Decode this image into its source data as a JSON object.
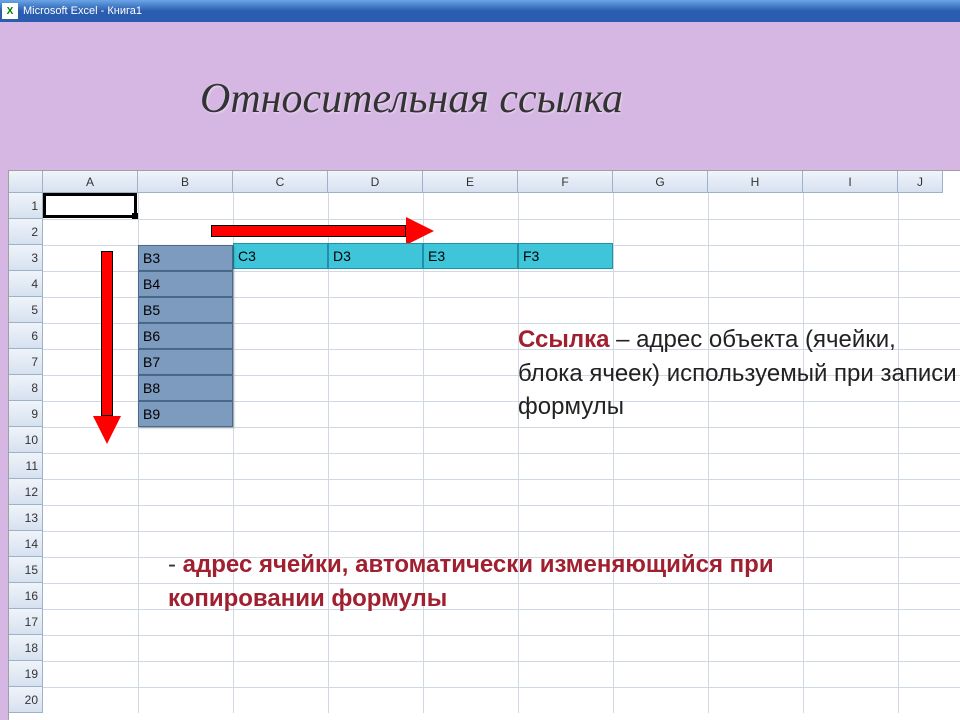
{
  "app_title": "Microsoft Excel - Книга1",
  "slide_heading": "Относительная ссылка",
  "columns": [
    "A",
    "B",
    "C",
    "D",
    "E",
    "F",
    "G",
    "H",
    "I",
    "J"
  ],
  "rows": [
    "1",
    "2",
    "3",
    "4",
    "5",
    "6",
    "7",
    "8",
    "9",
    "10",
    "11",
    "12",
    "13",
    "14",
    "15",
    "16",
    "17",
    "18",
    "19",
    "20"
  ],
  "vertical_cells": [
    "B3",
    "B4",
    "B5",
    "B6",
    "B7",
    "B8",
    "B9"
  ],
  "horizontal_cells": [
    "C3",
    "D3",
    "E3",
    "F3"
  ],
  "text1": {
    "part1": "Ссылка",
    "part2": " – адрес объекта (ячейки, блока ячеек) используемый при записи формулы"
  },
  "text2": {
    "dash": "- ",
    "s1": "адрес ячейки",
    "s2": ", автоматически ",
    "s3": "изменяющийся",
    "s4": " при копировании формулы"
  }
}
